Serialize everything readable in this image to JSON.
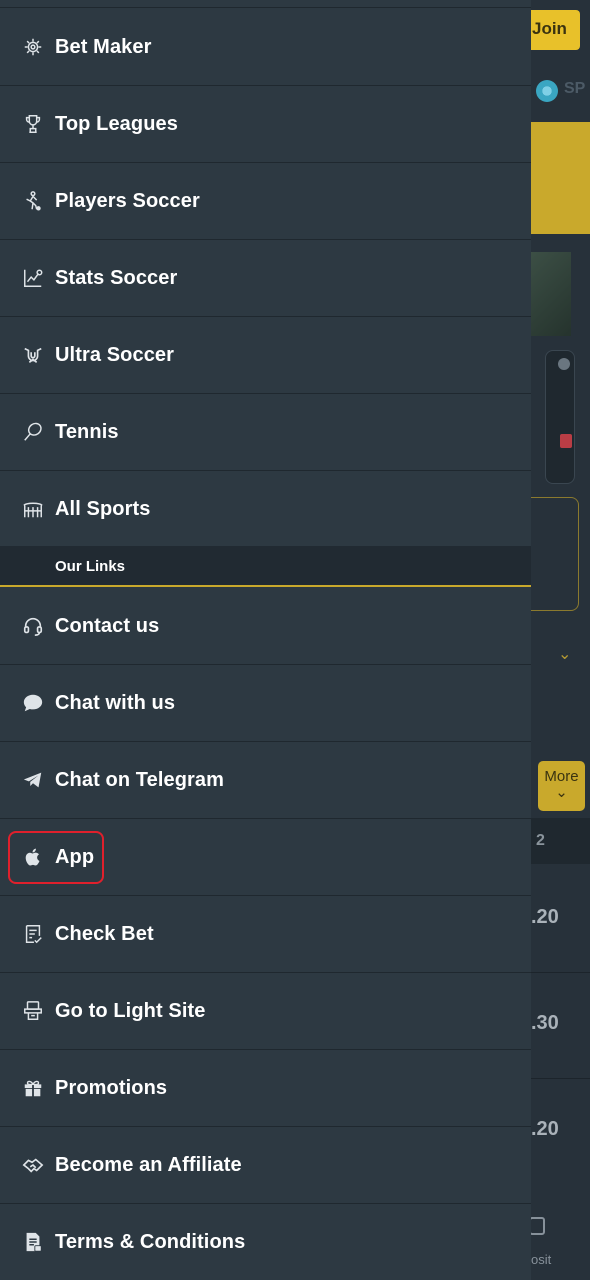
{
  "background": {
    "join_label": "Join",
    "sports_label_partial": "SP",
    "more_label": "More",
    "column_header": "2",
    "odds": [
      ".20",
      ".30",
      ".20"
    ],
    "deposit_label_partial": "osit",
    "accent_color": "#c9a92c"
  },
  "drawer": {
    "items": [
      {
        "label": "Bet Maker",
        "icon": "bet-maker-icon"
      },
      {
        "label": "Top Leagues",
        "icon": "trophy-icon"
      },
      {
        "label": "Players Soccer",
        "icon": "player-icon"
      },
      {
        "label": "Stats Soccer",
        "icon": "stats-chart-icon"
      },
      {
        "label": "Ultra Soccer",
        "icon": "ultra-soccer-icon"
      },
      {
        "label": "Tennis",
        "icon": "tennis-racket-icon"
      },
      {
        "label": "All Sports",
        "icon": "stadium-icon"
      }
    ],
    "section_title": "Our Links",
    "links": [
      {
        "label": "Contact us",
        "icon": "headset-icon"
      },
      {
        "label": "Chat with us",
        "icon": "chat-bubble-icon"
      },
      {
        "label": "Chat on Telegram",
        "icon": "telegram-icon"
      },
      {
        "label": "App",
        "icon": "apple-icon"
      },
      {
        "label": "Check Bet",
        "icon": "check-document-icon"
      },
      {
        "label": "Go to Light Site",
        "icon": "light-site-icon"
      },
      {
        "label": "Promotions",
        "icon": "gift-icon"
      },
      {
        "label": "Become an Affiliate",
        "icon": "handshake-icon"
      },
      {
        "label": "Terms & Conditions",
        "icon": "terms-document-icon"
      }
    ],
    "highlight_color": "#e0202c"
  }
}
